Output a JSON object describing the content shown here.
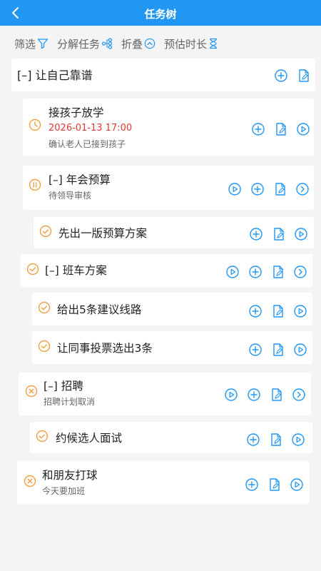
{
  "header": {
    "title": "任务树"
  },
  "toolbar": {
    "filter_label": "筛选",
    "decompose_label": "分解任务",
    "fold_label": "折叠",
    "estimate_label": "预估时长"
  },
  "colors": {
    "primary": "#2196f3",
    "warning": "#f0a040",
    "danger": "#e53935"
  },
  "tasks": {
    "root": {
      "name": "[–] 让自己靠谱"
    },
    "t1": {
      "name": "接孩子放学",
      "due": "2026-01-13 17:00",
      "note": "确认老人已接到孩子",
      "status": "clock"
    },
    "t2": {
      "name": "[–] 年会预算",
      "note": "待领导审核",
      "status": "paused"
    },
    "t3": {
      "name": "先出一版预算方案",
      "status": "done"
    },
    "t4": {
      "name": "[–] 班车方案",
      "status": "done"
    },
    "t5": {
      "name": "给出5条建议线路",
      "status": "done"
    },
    "t6": {
      "name": "让同事投票选出3条",
      "status": "done"
    },
    "t7": {
      "name": "[–] 招聘",
      "note": "招聘计划取消",
      "status": "cancelled"
    },
    "t8": {
      "name": "约候选人面试",
      "status": "done"
    },
    "t9": {
      "name": "和朋友打球",
      "note": "今天要加班",
      "status": "cancelled"
    }
  }
}
